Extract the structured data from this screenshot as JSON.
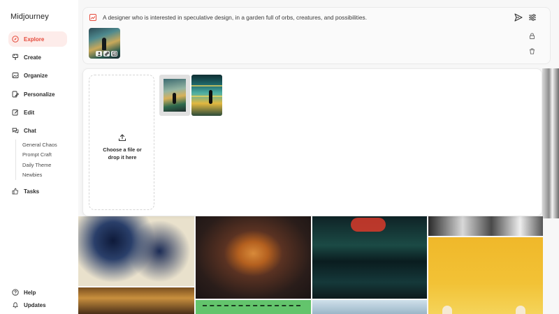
{
  "app": {
    "brand": "Midjourney"
  },
  "sidebar": {
    "items": [
      {
        "label": "Explore",
        "icon": "compass-icon",
        "active": true
      },
      {
        "label": "Create",
        "icon": "brush-icon"
      },
      {
        "label": "Organize",
        "icon": "image-icon"
      },
      {
        "label": "Personalize",
        "icon": "personalize-icon"
      },
      {
        "label": "Edit",
        "icon": "edit-icon"
      },
      {
        "label": "Chat",
        "icon": "chat-icon"
      }
    ],
    "chat_rooms": [
      "General Chaos",
      "Prompt Craft",
      "Daily Theme",
      "Newbies"
    ],
    "tasks": {
      "label": "Tasks",
      "icon": "thumbs-up-icon"
    },
    "help": {
      "label": "Help",
      "icon": "help-icon"
    },
    "updates": {
      "label": "Updates",
      "icon": "bell-icon"
    }
  },
  "prompt": {
    "text": "A designer who is interested in speculative design, in a garden full of orbs, creatures, and possibilities.",
    "icons": [
      "image-prompt-icon",
      "send-icon",
      "settings-icon",
      "lock-icon",
      "trash-icon"
    ],
    "thumbnail_badges": [
      "person-icon",
      "link-icon",
      "image-icon"
    ]
  },
  "upload": {
    "line1": "Choose a file or",
    "line2": "drop it here",
    "icon": "upload-icon"
  },
  "colors": {
    "accent": "#e5493a",
    "active_bg": "#fdecea",
    "main_bg": "#f7f7f7"
  }
}
